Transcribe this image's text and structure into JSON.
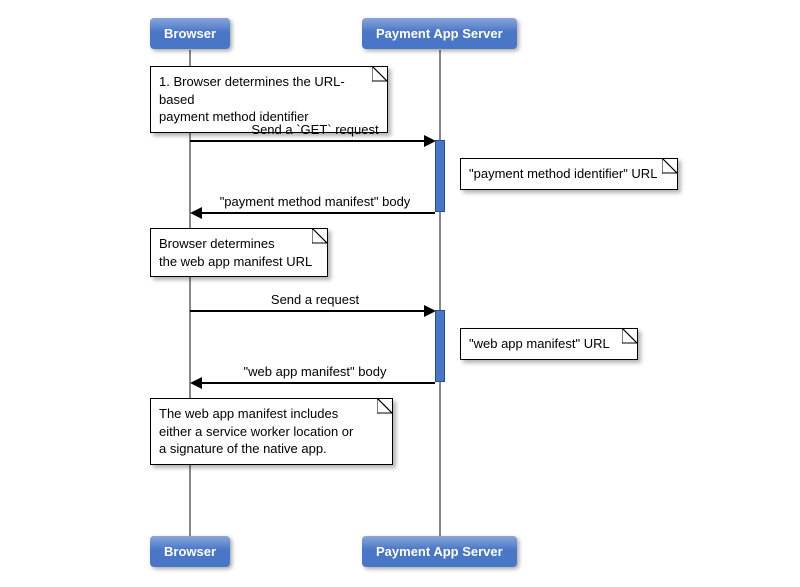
{
  "participants": {
    "left": "Browser",
    "right": "Payment App Server"
  },
  "notes": {
    "n1": "1. Browser determines the URL-based\npayment method identifier",
    "n2": "\"payment method identifier\" URL",
    "n3": "Browser determines\nthe web app manifest URL",
    "n4": "\"web app manifest\" URL",
    "n5": "The web app manifest includes\neither a service worker location or\na signature of the native app."
  },
  "messages": {
    "m1": "Send a `GET` request",
    "m2": "\"payment method manifest\" body",
    "m3": "Send a request",
    "m4": "\"web app manifest\" body"
  },
  "layout": {
    "leftX": 190,
    "rightX": 440,
    "topBoxY": 20,
    "bottomBoxY": 540,
    "lifeTop": 50,
    "lifeBottom": 540
  }
}
